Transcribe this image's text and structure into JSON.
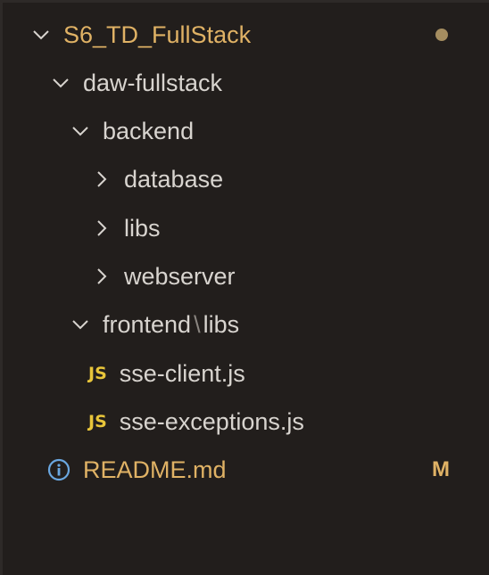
{
  "explorer": {
    "root": {
      "label": "S6_TD_FullStack",
      "status": "unsaved-dot",
      "icon": "chevron-down-icon"
    },
    "items": [
      {
        "label": "daw-fullstack",
        "icon": "chevron-down-icon"
      },
      {
        "label": "backend",
        "icon": "chevron-down-icon"
      },
      {
        "label": "database",
        "icon": "chevron-right-icon"
      },
      {
        "label": "libs",
        "icon": "chevron-right-icon"
      },
      {
        "label": "webserver",
        "icon": "chevron-right-icon"
      },
      {
        "label_part1": "frontend",
        "separator": "\\",
        "label_part2": "libs",
        "icon": "chevron-down-icon"
      },
      {
        "badge": "JS",
        "label": "sse-client.js"
      },
      {
        "badge": "JS",
        "label": "sse-exceptions.js"
      },
      {
        "label": "README.md",
        "icon": "info-icon",
        "git_status": "M"
      }
    ]
  },
  "colors": {
    "background": "#221e1c",
    "text": "#d8d4cf",
    "modified": "#e0b265",
    "js_badge": "#e8c53a",
    "info_icon": "#6aa7e0"
  }
}
